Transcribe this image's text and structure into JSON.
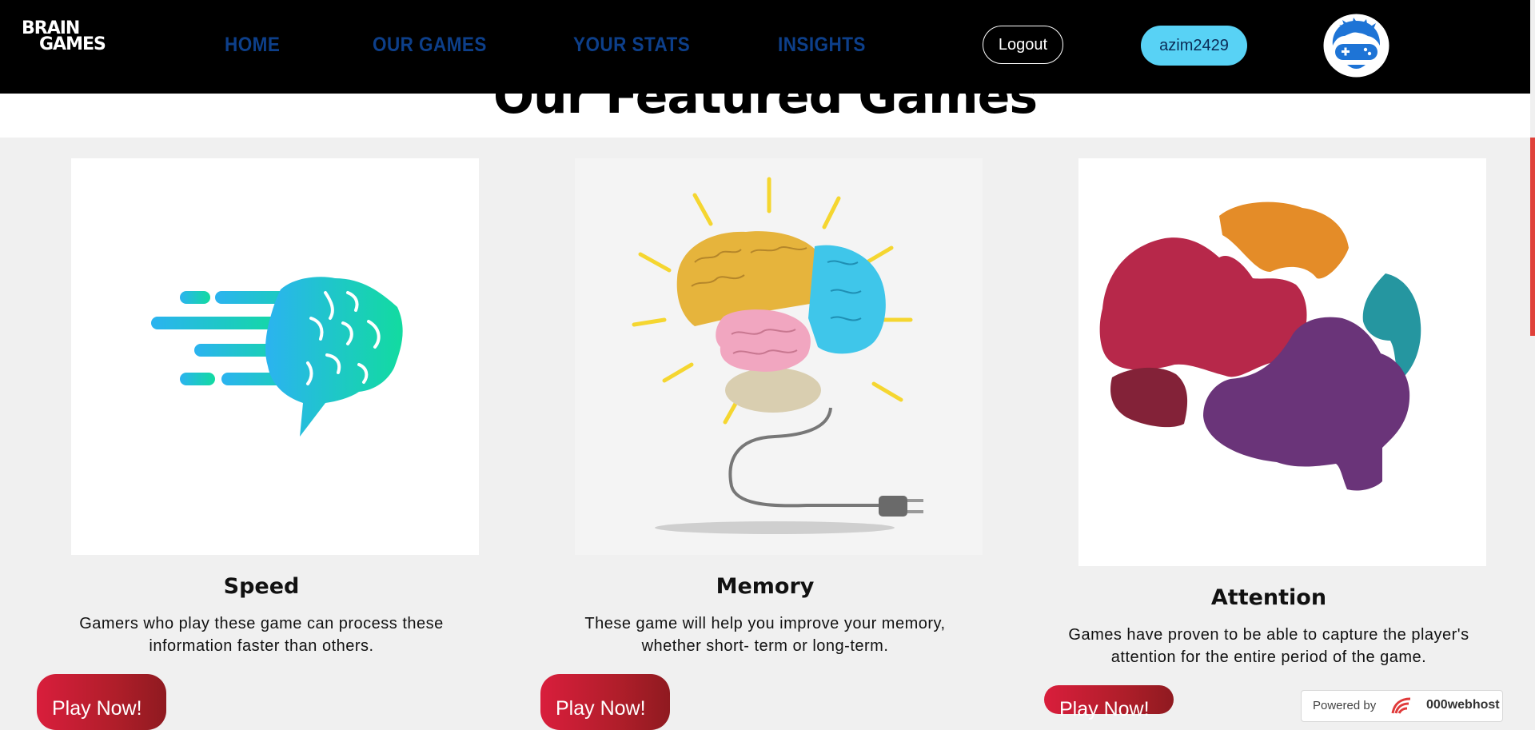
{
  "header": {
    "logo_line1": "BRAIN",
    "logo_line2": "GAMES",
    "nav": [
      "HOME",
      "OUR GAMES",
      "YOUR STATS",
      "INSIGHTS"
    ],
    "logout_label": "Logout",
    "username": "azim2429"
  },
  "section": {
    "title": "Our Featured Games"
  },
  "cards": [
    {
      "title": "Speed",
      "desc_line1": "Gamers who play these game can process these",
      "desc_line2": "information faster than others.",
      "button": "Play Now!"
    },
    {
      "title": "Memory",
      "desc_line1": "These game will help you improve your memory,",
      "desc_line2": "whether short- term or long-term.",
      "button": "Play Now!"
    },
    {
      "title": "Attention",
      "desc_line1": "Games have proven to be able to capture the player's",
      "desc_line2": "attention for the entire period of the game.",
      "button": "Play Now!"
    }
  ],
  "footer_badge": {
    "prefix": "Powered by",
    "brand": "000webhost"
  },
  "colors": {
    "header_bg": "#000000",
    "nav_text": "#0d3f8a",
    "user_button": "#58d2f5",
    "play_button": "#c81e32",
    "page_bg": "#f0f0f0"
  }
}
